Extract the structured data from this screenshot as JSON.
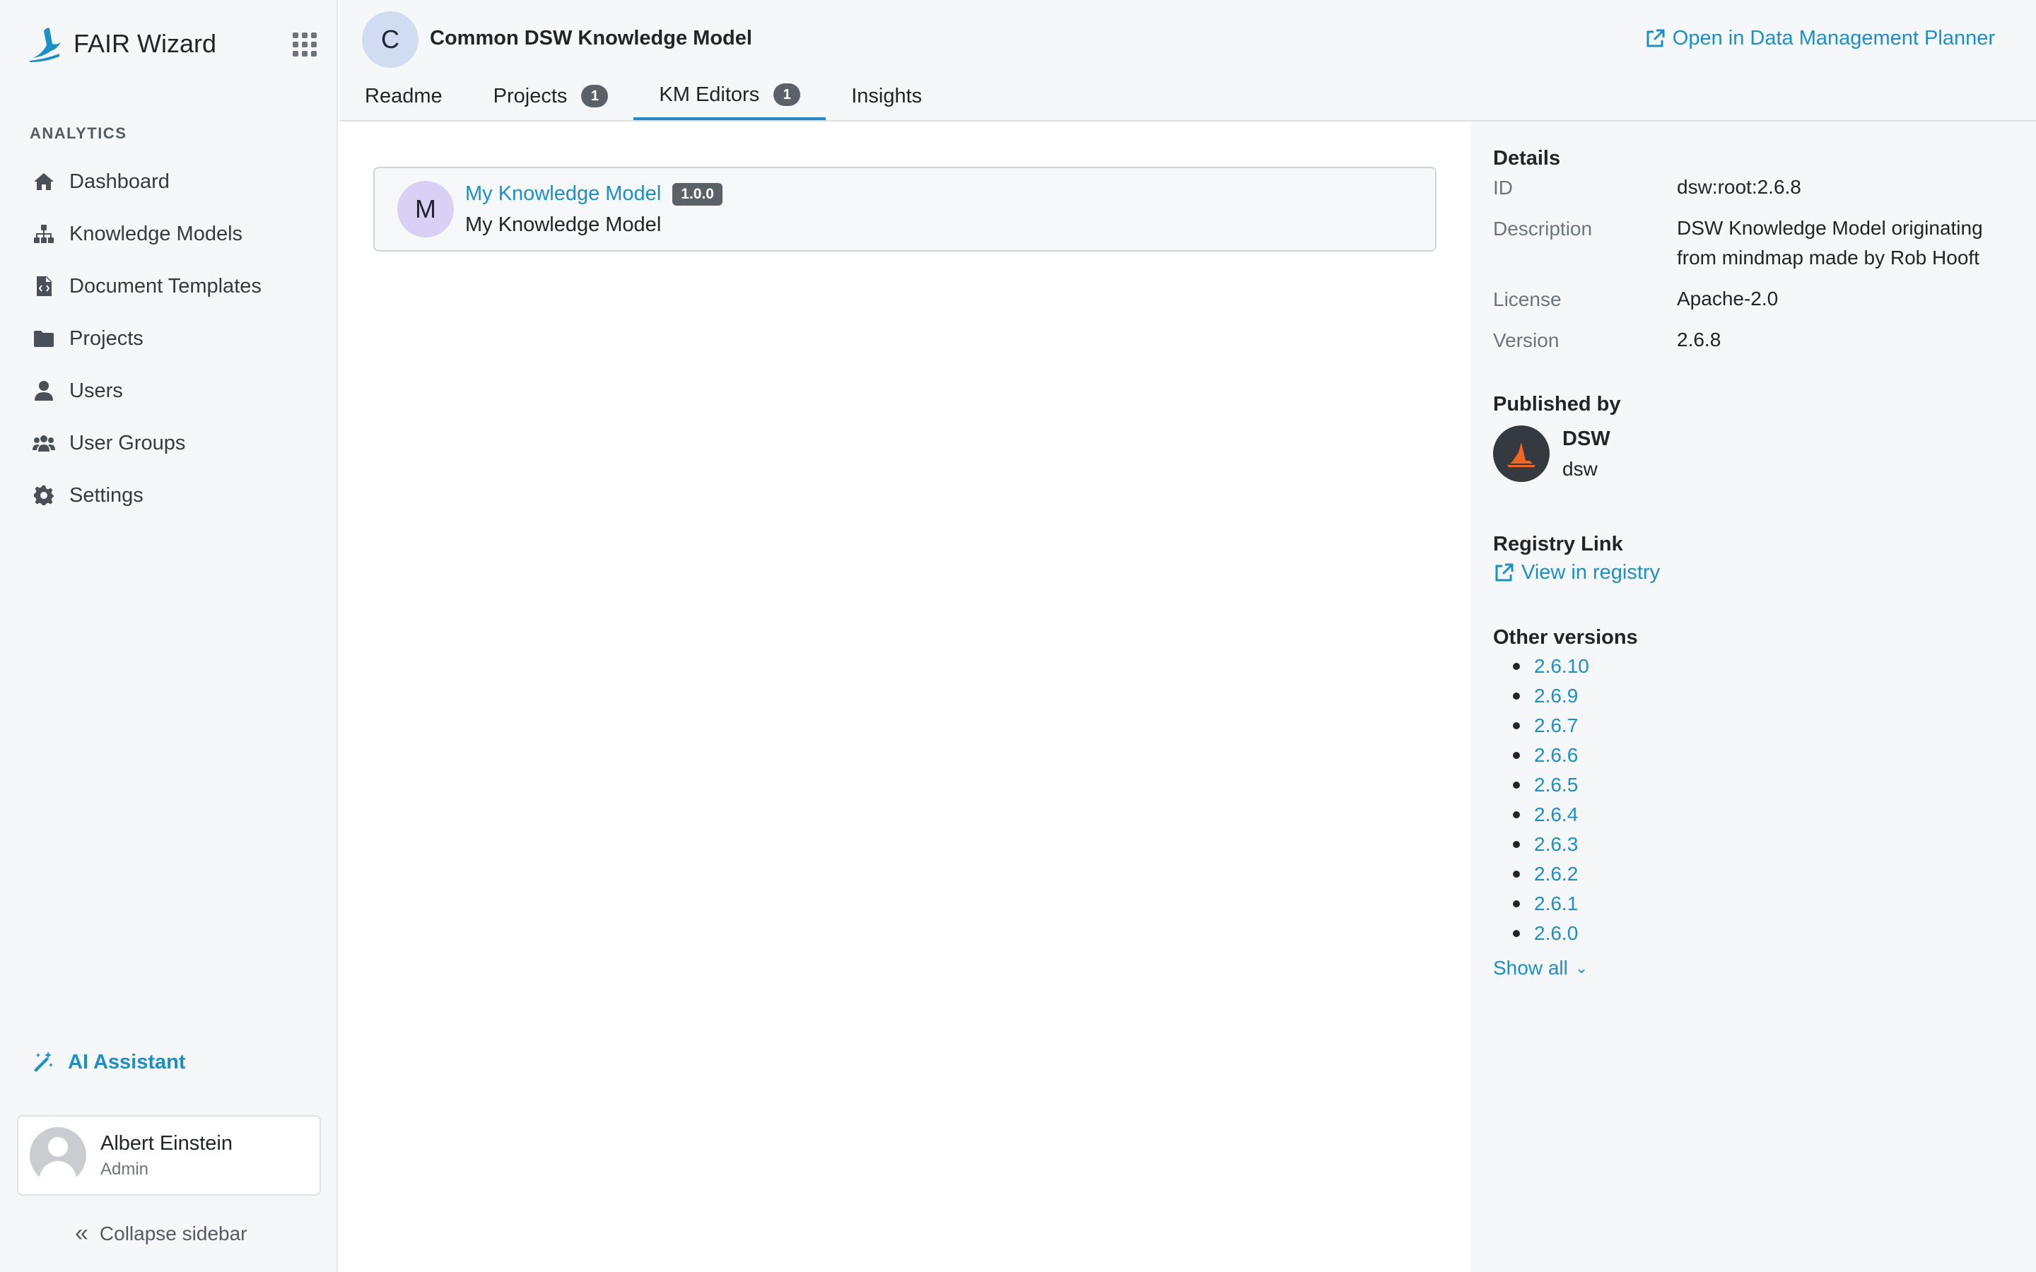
{
  "app": {
    "brand_name": "FAIR Wizard",
    "accent_color": "#1a8fc8"
  },
  "sidebar": {
    "section_label": "ANALYTICS",
    "items": [
      {
        "label": "Dashboard",
        "icon": "home-icon"
      },
      {
        "label": "Knowledge Models",
        "icon": "sitemap-icon"
      },
      {
        "label": "Document Templates",
        "icon": "file-code-icon"
      },
      {
        "label": "Projects",
        "icon": "folder-icon"
      },
      {
        "label": "Users",
        "icon": "user-icon"
      },
      {
        "label": "User Groups",
        "icon": "users-icon"
      },
      {
        "label": "Settings",
        "icon": "gear-icon"
      }
    ],
    "ai_assistant": "AI Assistant",
    "profile": {
      "name": "Albert Einstein",
      "role": "Admin"
    },
    "collapse": "Collapse sidebar"
  },
  "header": {
    "avatar_letter": "C",
    "title": "Common DSW Knowledge Model",
    "open_dmp": "Open in Data Management Planner",
    "tabs": [
      {
        "label": "Readme",
        "count": null,
        "active": false
      },
      {
        "label": "Projects",
        "count": "1",
        "active": false
      },
      {
        "label": "KM Editors",
        "count": "1",
        "active": true
      },
      {
        "label": "Insights",
        "count": null,
        "active": false
      }
    ]
  },
  "main": {
    "editors": [
      {
        "avatar_letter": "M",
        "name": "My Knowledge Model",
        "version": "1.0.0",
        "subtitle": "My Knowledge Model"
      }
    ]
  },
  "details": {
    "heading": "Details",
    "rows": [
      {
        "label": "ID",
        "value": "dsw:root:2.6.8"
      },
      {
        "label": "Description",
        "value": "DSW Knowledge Model originating from mindmap made by Rob Hooft"
      },
      {
        "label": "License",
        "value": "Apache-2.0"
      },
      {
        "label": "Version",
        "value": "2.6.8"
      }
    ],
    "published_heading": "Published by",
    "publisher_name": "DSW",
    "publisher_id": "dsw",
    "registry_heading": "Registry Link",
    "registry_link": "View in registry",
    "versions_heading": "Other versions",
    "versions": [
      "2.6.10",
      "2.6.9",
      "2.6.7",
      "2.6.6",
      "2.6.5",
      "2.6.4",
      "2.6.3",
      "2.6.2",
      "2.6.1",
      "2.6.0"
    ],
    "show_all": "Show all"
  }
}
